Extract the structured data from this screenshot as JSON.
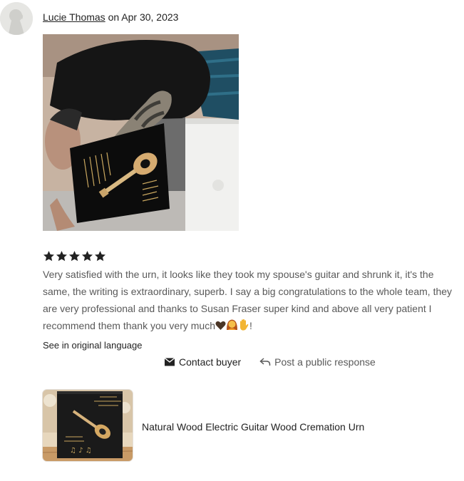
{
  "review": {
    "reviewer_name": "Lucie Thomas",
    "date_prefix": "on",
    "date": "Apr 30, 2023",
    "rating": 5,
    "rating_max": 5,
    "text": "Very satisfied with the urn, it looks like they took my spouse's guitar and shrunk it, it's the same, the writing is extraordinary, superb. I say a big congratulations to the whole team, they are very professional and thanks to Susan Fraser super kind and above all very patient I recommend them thank you very much",
    "emoji_suffix": "!",
    "emojis": [
      "brown-heart-emoji",
      "woman-emoji",
      "waving-hand-emoji"
    ],
    "see_original_label": "See in original language"
  },
  "actions": {
    "contact_label": "Contact buyer",
    "respond_label": "Post a public response"
  },
  "item": {
    "title": "Natural Wood Electric Guitar Wood Cremation Urn"
  },
  "colors": {
    "star": "#222222",
    "body_text": "#595959",
    "link_text": "#222222"
  }
}
